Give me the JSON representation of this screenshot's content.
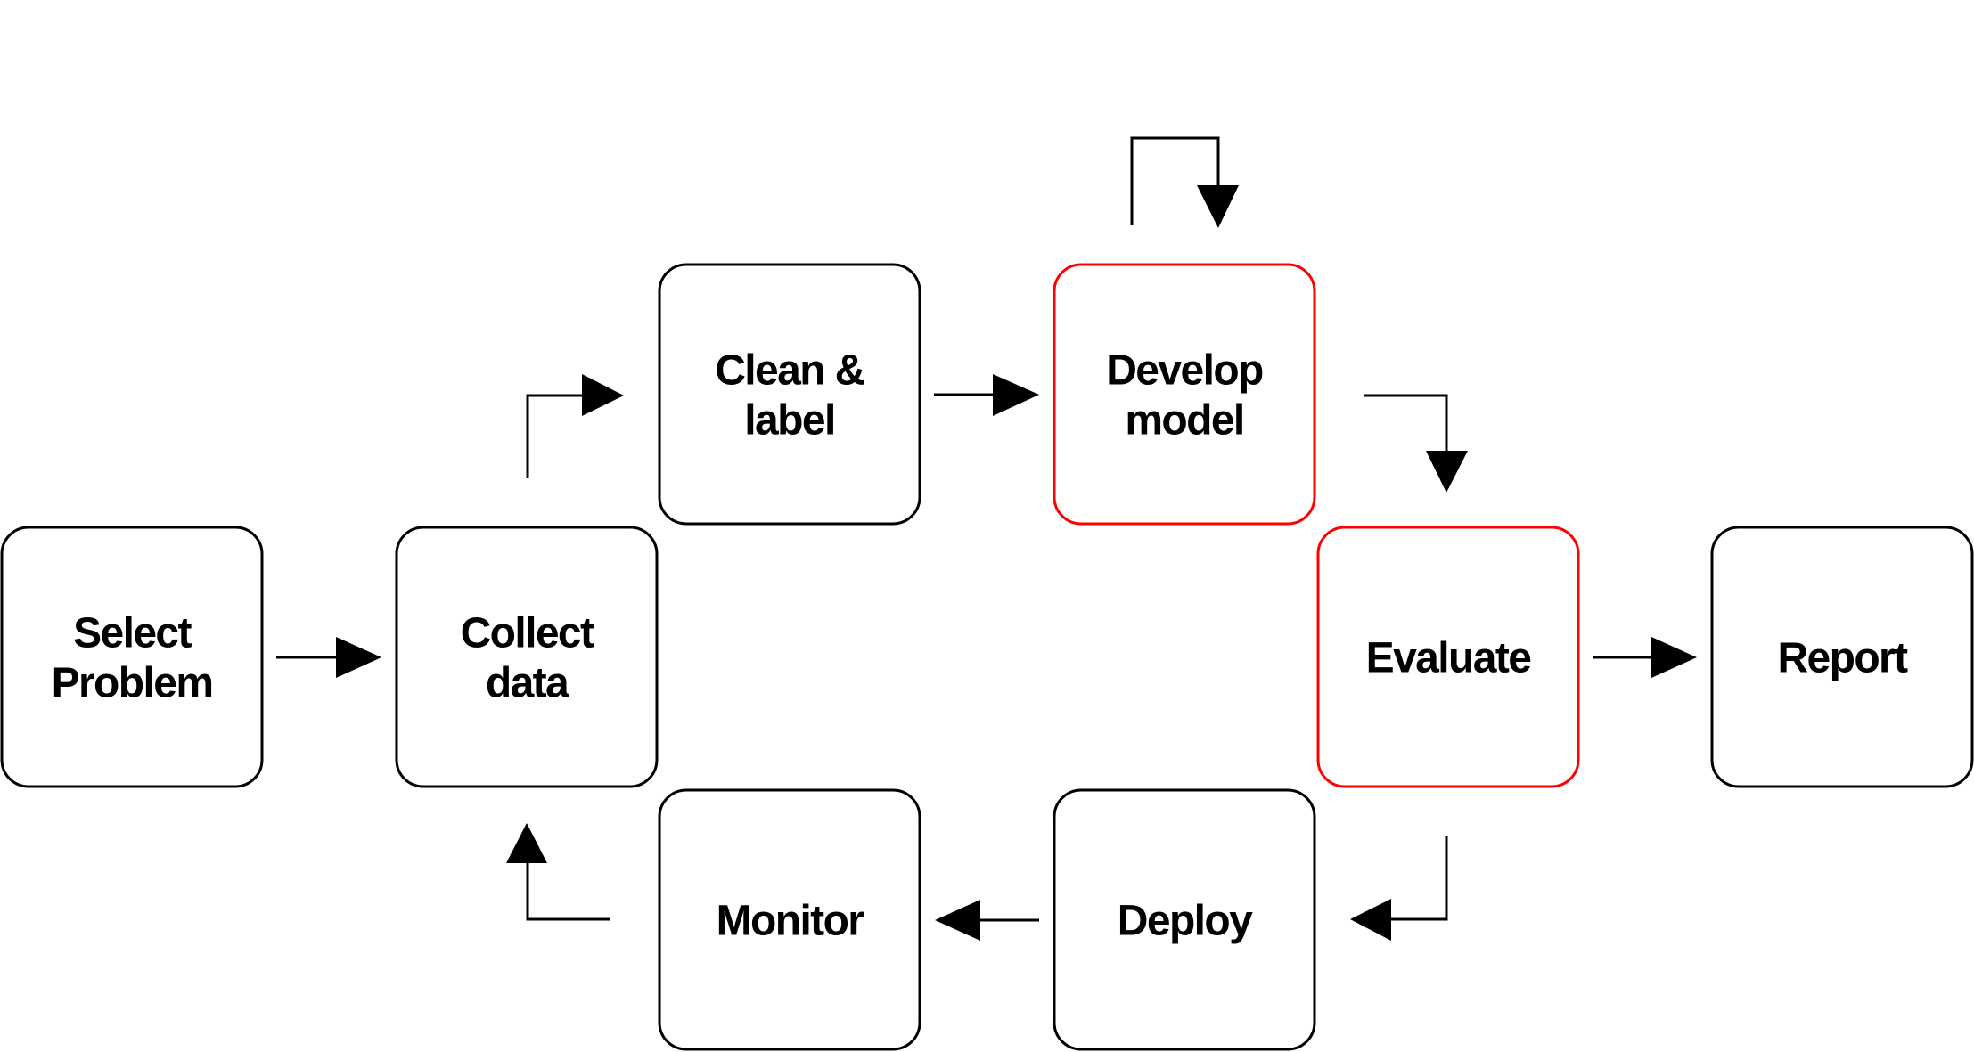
{
  "diagram": {
    "title": "",
    "colors": {
      "box_stroke": "#000000",
      "highlight_stroke": "#ff0000",
      "text": "#000000",
      "arrow": "#000000",
      "background": "#ffffff"
    },
    "nodes": [
      {
        "id": "select-problem",
        "lines": [
          "Select",
          "Problem"
        ],
        "highlighted": false
      },
      {
        "id": "collect-data",
        "lines": [
          "Collect",
          "data"
        ],
        "highlighted": false
      },
      {
        "id": "clean-label",
        "lines": [
          "Clean &",
          "label"
        ],
        "highlighted": false
      },
      {
        "id": "develop-model",
        "lines": [
          "Develop",
          "model"
        ],
        "highlighted": true
      },
      {
        "id": "evaluate",
        "lines": [
          "Evaluate"
        ],
        "highlighted": true
      },
      {
        "id": "report",
        "lines": [
          "Report"
        ],
        "highlighted": false
      },
      {
        "id": "deploy",
        "lines": [
          "Deploy"
        ],
        "highlighted": false
      },
      {
        "id": "monitor",
        "lines": [
          "Monitor"
        ],
        "highlighted": false
      }
    ],
    "edges": [
      {
        "from": "select-problem",
        "to": "collect-data",
        "icon": "arrow-right-icon"
      },
      {
        "from": "collect-data",
        "to": "clean-label",
        "icon": "arrow-up-right-elbow-icon"
      },
      {
        "from": "clean-label",
        "to": "develop-model",
        "icon": "arrow-right-icon"
      },
      {
        "from": "develop-model",
        "to": "develop-model",
        "icon": "loop-arrow-icon"
      },
      {
        "from": "develop-model",
        "to": "evaluate",
        "icon": "arrow-right-down-elbow-icon"
      },
      {
        "from": "evaluate",
        "to": "report",
        "icon": "arrow-right-icon"
      },
      {
        "from": "evaluate",
        "to": "deploy",
        "icon": "arrow-down-left-elbow-icon"
      },
      {
        "from": "deploy",
        "to": "monitor",
        "icon": "arrow-left-icon"
      },
      {
        "from": "monitor",
        "to": "collect-data",
        "icon": "arrow-left-up-elbow-icon"
      }
    ]
  }
}
